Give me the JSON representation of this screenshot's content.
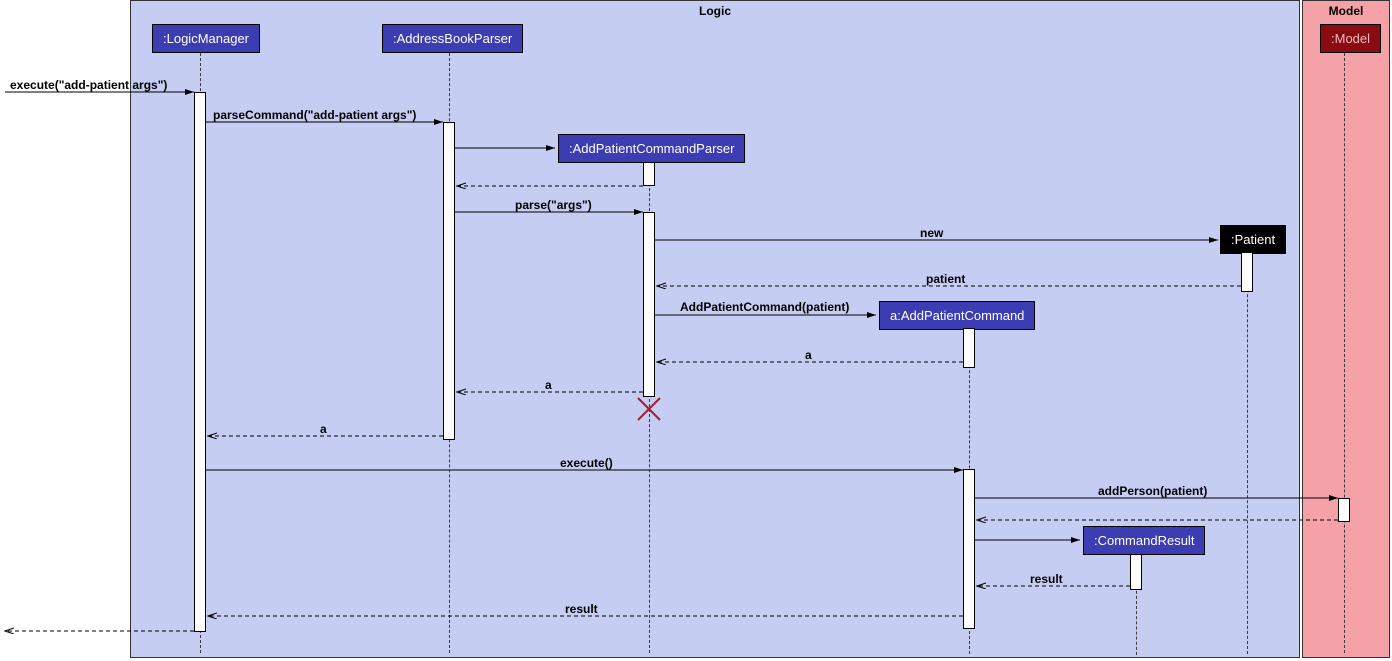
{
  "frames": {
    "logic": "Logic",
    "model": "Model"
  },
  "participants": {
    "logicManager": ":LogicManager",
    "addressBookParser": ":AddressBookParser",
    "addPatientCommandParser": ":AddPatientCommandParser",
    "patient": ":Patient",
    "addPatientCommand": "a:AddPatientCommand",
    "commandResult": ":CommandResult",
    "model": ":Model"
  },
  "messages": {
    "execute1": "execute(\"add-patient args\")",
    "parseCommand": "parseCommand(\"add-patient args\")",
    "parse": "parse(\"args\")",
    "new": "new",
    "returnPatient": "patient",
    "addPatientCommandCall": "AddPatientCommand(patient)",
    "returnA1": "a",
    "returnA2": "a",
    "returnA3": "a",
    "execute2": "execute()",
    "addPerson": "addPerson(patient)",
    "returnResult1": "result",
    "returnResult2": "result"
  }
}
